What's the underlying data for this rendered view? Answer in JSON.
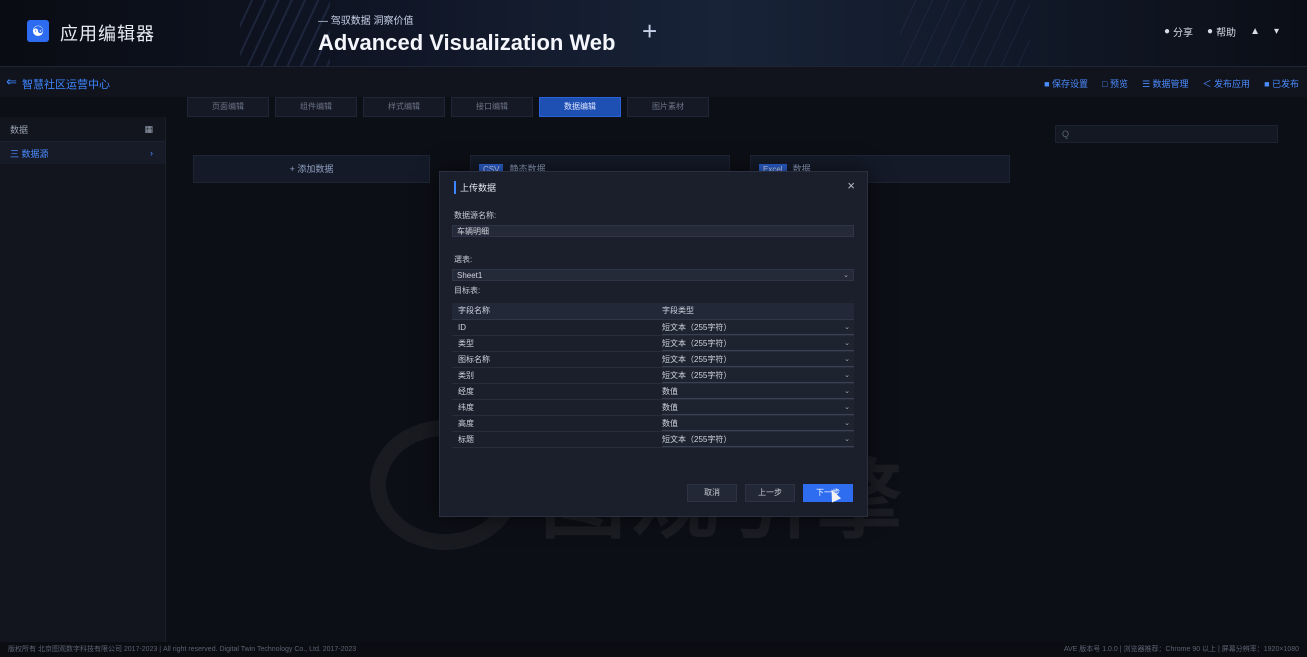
{
  "header": {
    "logo_glyph": "☯",
    "app_name": "应用编辑器",
    "slogan": "— 驾驭数据 洞察价值",
    "title": "Advanced Visualization Web",
    "plus": "+",
    "actions": [
      {
        "icon": "●",
        "label": "分享"
      },
      {
        "icon": "●",
        "label": "帮助"
      },
      {
        "icon": "▲",
        "label": ""
      },
      {
        "icon": "▾",
        "label": ""
      }
    ]
  },
  "breadcrumb": {
    "back": "⇐",
    "title": "智慧社区运营中心"
  },
  "toolbar": [
    "■ 保存设置",
    "□ 预览",
    "☰ 数据管理",
    "＜ 发布应用",
    "■ 已发布"
  ],
  "steps": [
    {
      "label": "页面编辑",
      "active": false
    },
    {
      "label": "组件编辑",
      "active": false
    },
    {
      "label": "样式编辑",
      "active": false
    },
    {
      "label": "接口编辑",
      "active": false
    },
    {
      "label": "数据编辑",
      "active": true
    },
    {
      "label": "图片素材",
      "active": false
    }
  ],
  "sidebar": {
    "header": "数据",
    "header_icon": "▦",
    "items": [
      {
        "label": "三 数据源",
        "arrow": "›"
      }
    ]
  },
  "search": {
    "placeholder": "Q"
  },
  "cards": [
    {
      "label": "+ 添加数据",
      "tag": ""
    },
    {
      "label": "静态数据",
      "tag": "CSV"
    },
    {
      "label": "数据",
      "tag": "Excel"
    }
  ],
  "watermark": "图观引擎",
  "modal": {
    "title": "上传数据",
    "close": "×",
    "name_label": "数据源名称:",
    "name_value": "车辆明细",
    "sheet_label": "選表:",
    "sheet_value": "Sheet1",
    "fields_label": "目标表:",
    "col_name": "字段名称",
    "col_type": "字段类型",
    "rows": [
      {
        "name": "ID",
        "type": "短文本（255字符）"
      },
      {
        "name": "类型",
        "type": "短文本（255字符）"
      },
      {
        "name": "图标名称",
        "type": "短文本（255字符）"
      },
      {
        "name": "类别",
        "type": "短文本（255字符）"
      },
      {
        "name": "经度",
        "type": "数值"
      },
      {
        "name": "纬度",
        "type": "数值"
      },
      {
        "name": "高度",
        "type": "数值"
      },
      {
        "name": "标题",
        "type": "短文本（255字符）"
      }
    ],
    "cancel": "取消",
    "prev": "上一步",
    "next": "下一步",
    "arrow": "⌄"
  },
  "footer": {
    "left": "版权所有 北京图观数字科技有限公司 2017-2023 | All right reserved. Digital Twin Technology Co., Ltd. 2017-2023",
    "right": "AVE 版本号 1.0.0 | 浏览器推荐：Chrome 90 以上 | 屏幕分辨率：1920×1080"
  }
}
